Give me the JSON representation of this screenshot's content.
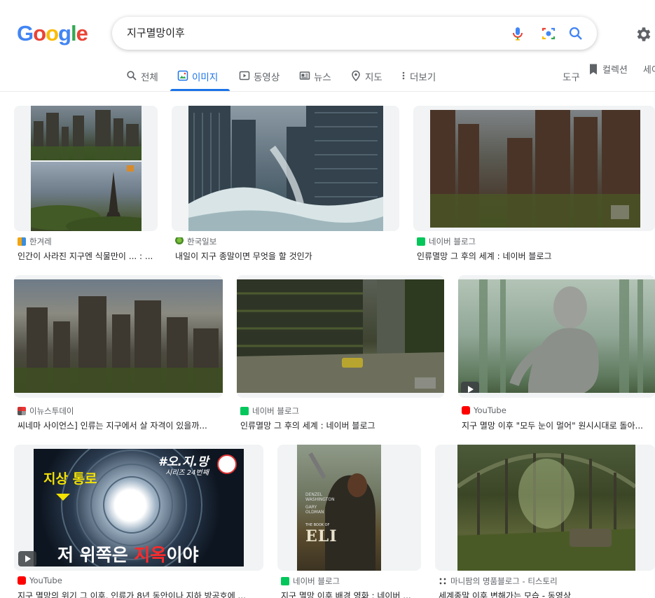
{
  "logo": {
    "letters": [
      "G",
      "o",
      "o",
      "g",
      "l",
      "e"
    ],
    "colors": [
      "#4285f4",
      "#ea4335",
      "#fbbc05",
      "#4285f4",
      "#34a853",
      "#ea4335"
    ]
  },
  "search": {
    "query": "지구멸망이후"
  },
  "icons": {
    "mic": "microphone-icon",
    "lens": "camera-lens-icon",
    "search": "search-icon",
    "settings": "gear-icon"
  },
  "tabs": [
    {
      "label": "전체",
      "icon": "search-icon"
    },
    {
      "label": "이미지",
      "icon": "image-icon",
      "active": true
    },
    {
      "label": "동영상",
      "icon": "play-icon"
    },
    {
      "label": "뉴스",
      "icon": "news-icon"
    },
    {
      "label": "지도",
      "icon": "map-pin-icon"
    },
    {
      "label": "더보기",
      "icon": "more-vert-icon"
    }
  ],
  "toolbar": {
    "tools": "도구",
    "collections": "컬렉션",
    "cut_label": "세이"
  },
  "accent": "#1a73e8",
  "results": [
    {
      "source": "한겨레",
      "title": "인간이 사라진 지구엔 식물만이 ... : ..."
    },
    {
      "source": "한국일보",
      "title": "내일이 지구 종말이면 무엇을 할 것인가"
    },
    {
      "source": "네이버 블로그",
      "title": "인류멸망 그 후의 세계 : 네이버 블로그"
    },
    {
      "source": "이뉴스투데이",
      "title": "씨네마 사이언스] 인류는 지구에서 살 자격이 있을까..."
    },
    {
      "source": "네이버 블로그",
      "title": "인류멸망 그 후의 세계 : 네이버 블로그"
    },
    {
      "source": "YouTube",
      "title": "지구 멸망 이후 \"모두 눈이 멀어\" 원시시대로 돌아..."
    },
    {
      "source": "YouTube",
      "title": "지구 멸망의 위기 그 이후, 인류가 8년 동안이나 지하 방공호에 ..."
    },
    {
      "source": "네이버 블로그",
      "title": "지구 멸망 이후 배경 영화 : 네이버 ..."
    },
    {
      "source": "마니팜의 명품블로그 - 티스토리",
      "title": "세계종말 이후 변해가는 모습 - 동영상"
    }
  ],
  "thumb_text": {
    "channel_tag": "#오.지.망",
    "series_tag": "시리즈 24번째",
    "top_caption": "지상 통로",
    "bottom_caption_a": "저 위쪽은 ",
    "bottom_caption_b": "지옥",
    "bottom_caption_c": "이야",
    "poster_actor_1": "DENZEL",
    "poster_actor_1b": "WASHINGTON",
    "poster_actor_2": "GARY",
    "poster_actor_2b": "OLDMAN",
    "poster_the_book_of": "THE BOOK OF",
    "poster_title": "ELI"
  }
}
